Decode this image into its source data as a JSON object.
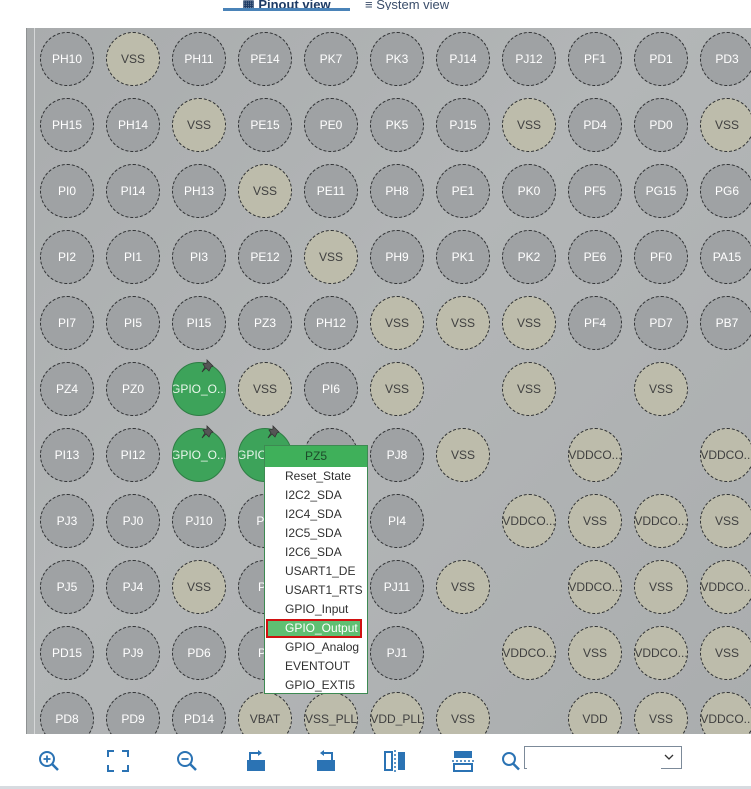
{
  "tabs": {
    "pinout": "Pinout view",
    "system": "System view"
  },
  "pins": [
    [
      "PH10",
      "VSS",
      "PH11",
      "PE14",
      "PK7",
      "PK3",
      "PJ14",
      "PJ12",
      "PF1",
      "PD1",
      "PD3"
    ],
    [
      "PH15",
      "PH14",
      "VSS",
      "PE15",
      "PE0",
      "PK5",
      "PJ15",
      "VSS",
      "PD4",
      "PD0",
      "VSS"
    ],
    [
      "PI0",
      "PI14",
      "PH13",
      "VSS",
      "PE11",
      "PH8",
      "PE1",
      "PK0",
      "PF5",
      "PG15",
      "PG6"
    ],
    [
      "PI2",
      "PI1",
      "PI3",
      "PE12",
      "VSS",
      "PH9",
      "PK1",
      "PK2",
      "PE6",
      "PF0",
      "PA15"
    ],
    [
      "PI7",
      "PI5",
      "PI15",
      "PZ3",
      "PH12",
      "VSS",
      "VSS",
      "VSS",
      "PF4",
      "PD7",
      "PB7"
    ],
    [
      "PZ4",
      "PZ0",
      "GPIO_O...",
      "VSS",
      "PI6",
      "VSS",
      "",
      "VSS",
      "",
      "VSS",
      ""
    ],
    [
      "PI13",
      "PI12",
      "GPIO_O...",
      "GPIO_O...",
      "PZ5",
      "PJ8",
      "VSS",
      "",
      "VDDCO...",
      "",
      "VDDCO..."
    ],
    [
      "PJ3",
      "PJ0",
      "PJ10",
      "PG",
      "",
      "PI4",
      "",
      "VDDCO...",
      "VSS",
      "VDDCO...",
      "VSS"
    ],
    [
      "PJ5",
      "PJ4",
      "VSS",
      "PJ",
      "",
      "PJ11",
      "VSS",
      "",
      "VDDCO...",
      "VSS",
      "VDDCO..."
    ],
    [
      "PD15",
      "PJ9",
      "PD6",
      "PJ",
      "",
      "PJ1",
      "",
      "VDDCO...",
      "VSS",
      "VDDCO...",
      "VSS"
    ],
    [
      "PD8",
      "PD9",
      "PD14",
      "VBAT",
      "VSS_PLL",
      "VDD_PLL",
      "VSS",
      "",
      "VDD",
      "VSS",
      "VDDCO..."
    ]
  ],
  "context_menu": {
    "pin": "PZ5",
    "items": [
      "Reset_State",
      "I2C2_SDA",
      "I2C4_SDA",
      "I2C5_SDA",
      "I2C6_SDA",
      "USART1_DE",
      "USART1_RTS",
      "GPIO_Input",
      "GPIO_Output",
      "GPIO_Analog",
      "EVENTOUT",
      "GPIO_EXTI5"
    ],
    "selected": "GPIO_Output"
  },
  "toolbar": {
    "icons": [
      "zoom-in-icon",
      "fit-to-window-icon",
      "zoom-out-icon",
      "rotate-right-icon",
      "rotate-left-icon",
      "flip-vertical-icon",
      "flip-horizontal-icon",
      "search-icon"
    ]
  },
  "search": {
    "value": "",
    "placeholder": ""
  },
  "colors": {
    "gpio_pin": "#3da35a",
    "power_pin": "#bdbcab",
    "signal_pin": "#9fa2a4",
    "menu_header": "#3fb05a",
    "highlight_border": "#d01010"
  }
}
